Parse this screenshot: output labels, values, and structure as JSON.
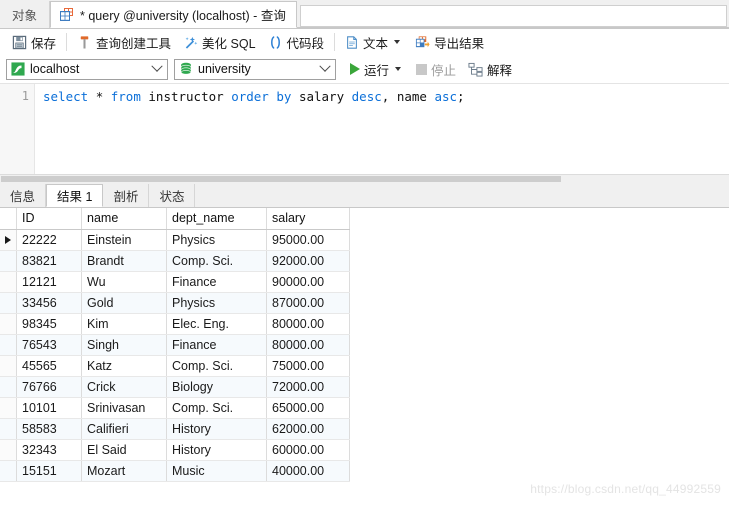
{
  "window": {
    "tabs": [
      {
        "label": "对象",
        "icon": "objects-icon",
        "active": false
      },
      {
        "label": "* query @university (localhost) - 查询",
        "icon": "query-table-icon",
        "active": true
      }
    ]
  },
  "toolbar": {
    "save_label": "保存",
    "query_builder_label": "查询创建工具",
    "beautify_sql_label": "美化 SQL",
    "code_snippet_label": "代码段",
    "text_label": "文本",
    "export_result_label": "导出结果",
    "icons": {
      "save": "floppy-disk-icon",
      "query_builder": "hammer-icon",
      "beautify": "magic-wand-icon",
      "snippet": "parentheses-icon",
      "text": "document-icon",
      "export": "export-table-icon"
    }
  },
  "connection_bar": {
    "host": {
      "value": "localhost",
      "icon": "connection-icon"
    },
    "database": {
      "value": "university",
      "icon": "database-icon"
    },
    "run_label": "运行",
    "stop_label": "停止",
    "explain_label": "解释"
  },
  "editor": {
    "line_number": "1",
    "sql_tokens": [
      {
        "t": "select",
        "k": "kw"
      },
      {
        "t": " ",
        "k": "op"
      },
      {
        "t": "*",
        "k": "op"
      },
      {
        "t": " ",
        "k": "op"
      },
      {
        "t": "from",
        "k": "kw"
      },
      {
        "t": " ",
        "k": "op"
      },
      {
        "t": "instructor",
        "k": "id"
      },
      {
        "t": " ",
        "k": "op"
      },
      {
        "t": "order",
        "k": "kw"
      },
      {
        "t": " ",
        "k": "op"
      },
      {
        "t": "by",
        "k": "kw"
      },
      {
        "t": " ",
        "k": "op"
      },
      {
        "t": "salary",
        "k": "id"
      },
      {
        "t": " ",
        "k": "op"
      },
      {
        "t": "desc",
        "k": "kw"
      },
      {
        "t": ", ",
        "k": "op"
      },
      {
        "t": "name",
        "k": "id"
      },
      {
        "t": " ",
        "k": "op"
      },
      {
        "t": "asc",
        "k": "kw"
      },
      {
        "t": ";",
        "k": "op"
      }
    ],
    "sql_text": "select * from instructor order by salary desc, name asc;"
  },
  "result_tabs": [
    {
      "label": "信息",
      "active": false
    },
    {
      "label": "结果 1",
      "active": true
    },
    {
      "label": "剖析",
      "active": false
    },
    {
      "label": "状态",
      "active": false
    }
  ],
  "grid": {
    "columns": [
      "ID",
      "name",
      "dept_name",
      "salary"
    ],
    "selected_column": "ID",
    "current_row_index": 0,
    "rows": [
      [
        "22222",
        "Einstein",
        "Physics",
        "95000.00"
      ],
      [
        "83821",
        "Brandt",
        "Comp. Sci.",
        "92000.00"
      ],
      [
        "12121",
        "Wu",
        "Finance",
        "90000.00"
      ],
      [
        "33456",
        "Gold",
        "Physics",
        "87000.00"
      ],
      [
        "98345",
        "Kim",
        "Elec. Eng.",
        "80000.00"
      ],
      [
        "76543",
        "Singh",
        "Finance",
        "80000.00"
      ],
      [
        "45565",
        "Katz",
        "Comp. Sci.",
        "75000.00"
      ],
      [
        "76766",
        "Crick",
        "Biology",
        "72000.00"
      ],
      [
        "10101",
        "Srinivasan",
        "Comp. Sci.",
        "65000.00"
      ],
      [
        "58583",
        "Califieri",
        "History",
        "62000.00"
      ],
      [
        "32343",
        "El Said",
        "History",
        "60000.00"
      ],
      [
        "15151",
        "Mozart",
        "Music",
        "40000.00"
      ]
    ]
  },
  "watermark": "https://blog.csdn.net/qq_44992559",
  "colors": {
    "accent_blue": "#0b6fd8",
    "run_green": "#3aa63a",
    "header_select": "#d9eaf7",
    "alt_row": "#f6fafd"
  }
}
